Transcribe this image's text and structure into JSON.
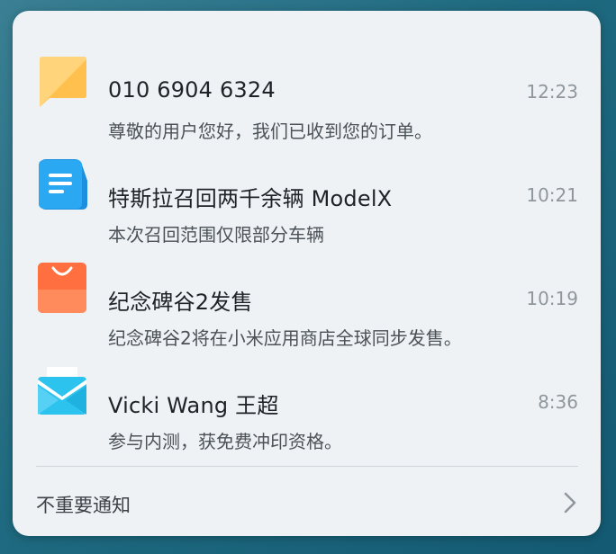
{
  "notifications": [
    {
      "icon": "message-icon",
      "title": "010 6904 6324",
      "message": "尊敬的用户您好，我们已收到您的订单。",
      "time": "12:23",
      "accent": "#ffc04d"
    },
    {
      "icon": "document-icon",
      "title": "特斯拉召回两千余辆 ModelX",
      "message": "本次召回范围仅限部分车辆",
      "time": "10:21",
      "accent": "#2aa8f2"
    },
    {
      "icon": "shopping-bag-icon",
      "title": "纪念碑谷2发售",
      "message": "纪念碑谷2将在小米应用商店全球同步发售。",
      "time": "10:19",
      "accent": "#ff6f40"
    },
    {
      "icon": "mail-icon",
      "title": "Vicki Wang 王超",
      "message": "参与内测，获免费冲印资格。",
      "time": "8:36",
      "accent": "#2cc3ef"
    }
  ],
  "footer": {
    "label": "不重要通知"
  }
}
